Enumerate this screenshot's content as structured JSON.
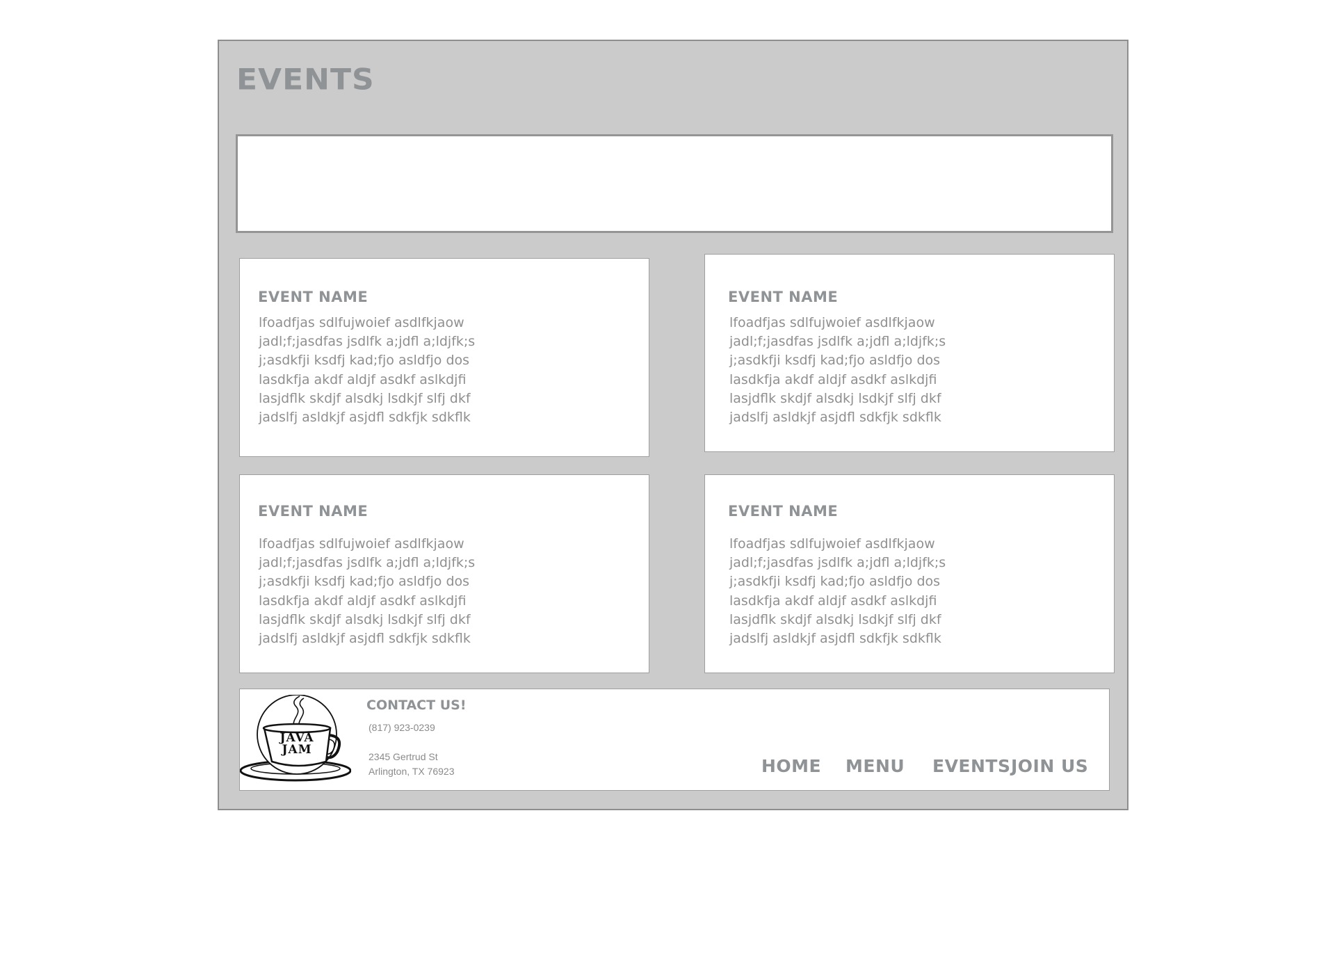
{
  "header": {
    "title": "EVENTS"
  },
  "events": [
    {
      "name": "EVENT NAME",
      "description": "lfoadfjas sdlfujwoief asdlfkjaow\njadl;f;jasdfas jsdlfk a;jdfl a;ldjfk;s\nj;asdkfji ksdfj kad;fjo asldfjo dos\nlasdkfja akdf aldjf asdkf  aslkdjfi\nlasjdflk skdjf alsdkj lsdkjf slfj dkf\njadslfj asldkjf asjdfl sdkfjk sdkflk"
    },
    {
      "name": "EVENT NAME",
      "description": "lfoadfjas sdlfujwoief asdlfkjaow\njadl;f;jasdfas jsdlfk a;jdfl a;ldjfk;s\nj;asdkfji ksdfj kad;fjo asldfjo dos\nlasdkfja akdf aldjf asdkf  aslkdjfi\nlasjdflk skdjf alsdkj lsdkjf slfj dkf\njadslfj asldkjf asjdfl sdkfjk sdkflk"
    },
    {
      "name": "EVENT NAME",
      "description": "lfoadfjas sdlfujwoief asdlfkjaow\njadl;f;jasdfas jsdlfk a;jdfl a;ldjfk;s\nj;asdkfji ksdfj kad;fjo asldfjo dos\nlasdkfja akdf aldjf asdkf  aslkdjfi\nlasjdflk skdjf alsdkj lsdkjf slfj dkf\njadslfj asldkjf asjdfl sdkfjk sdkflk"
    },
    {
      "name": "EVENT NAME",
      "description": "lfoadfjas sdlfujwoief asdlfkjaow\njadl;f;jasdfas jsdlfk a;jdfl a;ldjfk;s\nj;asdkfji ksdfj kad;fjo asldfjo dos\nlasdkfja akdf aldjf asdkf  aslkdjfi\nlasjdflk skdjf alsdkj lsdkjf slfj dkf\njadslfj asldkjf asjdfl sdkfjk sdkflk"
    }
  ],
  "footer": {
    "logo_text": "JAVA JAM",
    "contact_title": "CONTACT US!",
    "phone": "(817) 923-0239",
    "address_line1": "2345 Gertrud St",
    "address_line2": "Arlington, TX 76923",
    "nav": [
      {
        "label": "HOME"
      },
      {
        "label": "MENU"
      },
      {
        "label": "EVENTS"
      },
      {
        "label": "JOIN US"
      }
    ]
  },
  "colors": {
    "frame_bg": "#cbcbcb",
    "frame_border": "#8e8e8e",
    "heading": "#8f9396",
    "body_text": "#8f8f8f",
    "card_bg": "#ffffff"
  }
}
